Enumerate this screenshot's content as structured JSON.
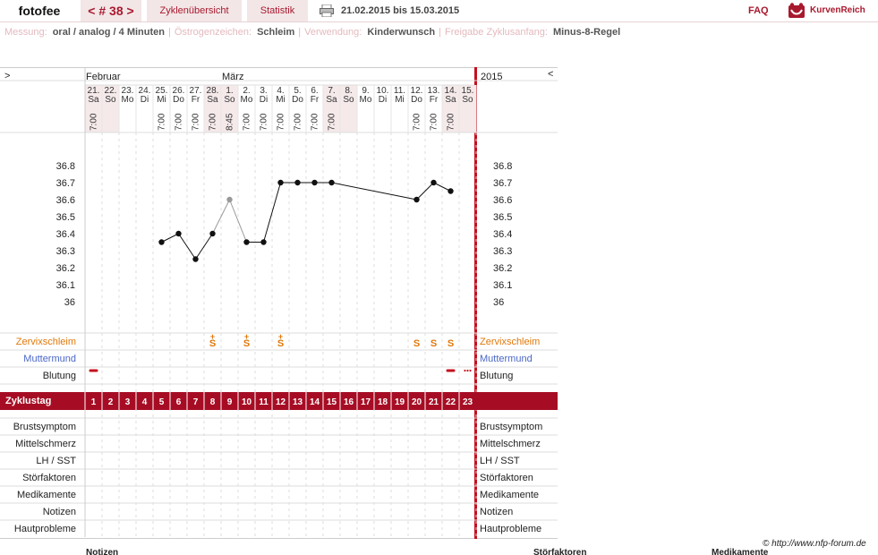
{
  "topbar": {
    "user": "fotofee",
    "cycle_label": "< # 38 >",
    "nav_overview": "Zyklenübersicht",
    "nav_stats": "Statistik",
    "date_range": "21.02.2015 bis 15.03.2015",
    "faq": "FAQ",
    "brand": "KurvenReich"
  },
  "meta": {
    "measure_key": "Messung:",
    "measure_val": "oral / analog / 4 Minuten",
    "oestro_key": "Östrogenzeichen:",
    "oestro_val": "Schleim",
    "use_key": "Verwendung:",
    "use_val": "Kinderwunsch",
    "free_key": "Freigabe Zyklusanfang:",
    "free_val": "Minus-8-Regel"
  },
  "header": {
    "left_arrow": ">",
    "right_arrow": "<",
    "month_feb": "Februar",
    "month_mar": "März",
    "year": "2015"
  },
  "chart_data": {
    "type": "line",
    "ylabel": "",
    "ylim": [
      35.9,
      36.95
    ],
    "ticks": [
      "36.8",
      "36.7",
      "36.6",
      "36.5",
      "36.4",
      "36.3",
      "36.2",
      "36.1",
      "36"
    ],
    "days": [
      {
        "date": "21.",
        "wd": "Sa",
        "time": "7:00",
        "weekend": true
      },
      {
        "date": "22.",
        "wd": "So",
        "time": "",
        "weekend": true
      },
      {
        "date": "23.",
        "wd": "Mo",
        "time": "",
        "weekend": false
      },
      {
        "date": "24.",
        "wd": "Di",
        "time": "",
        "weekend": false
      },
      {
        "date": "25.",
        "wd": "Mi",
        "time": "7:00",
        "weekend": false
      },
      {
        "date": "26.",
        "wd": "Do",
        "time": "7:00",
        "weekend": false
      },
      {
        "date": "27.",
        "wd": "Fr",
        "time": "7:00",
        "weekend": false
      },
      {
        "date": "28.",
        "wd": "Sa",
        "time": "7:00",
        "weekend": true
      },
      {
        "date": "1.",
        "wd": "So",
        "time": "8:45",
        "weekend": true
      },
      {
        "date": "2.",
        "wd": "Mo",
        "time": "7:00",
        "weekend": false
      },
      {
        "date": "3.",
        "wd": "Di",
        "time": "7:00",
        "weekend": false
      },
      {
        "date": "4.",
        "wd": "Mi",
        "time": "7:00",
        "weekend": false
      },
      {
        "date": "5.",
        "wd": "Do",
        "time": "7:00",
        "weekend": false
      },
      {
        "date": "6.",
        "wd": "Fr",
        "time": "7:00",
        "weekend": false
      },
      {
        "date": "7.",
        "wd": "Sa",
        "time": "7:00",
        "weekend": true
      },
      {
        "date": "8.",
        "wd": "So",
        "time": "",
        "weekend": true
      },
      {
        "date": "9.",
        "wd": "Mo",
        "time": "",
        "weekend": false
      },
      {
        "date": "10.",
        "wd": "Di",
        "time": "",
        "weekend": false
      },
      {
        "date": "11.",
        "wd": "Mi",
        "time": "",
        "weekend": false
      },
      {
        "date": "12.",
        "wd": "Do",
        "time": "7:00",
        "weekend": false
      },
      {
        "date": "13.",
        "wd": "Fr",
        "time": "7:00",
        "weekend": false
      },
      {
        "date": "14.",
        "wd": "Sa",
        "time": "7:00",
        "weekend": true
      },
      {
        "date": "15.",
        "wd": "So",
        "time": "",
        "weekend": true
      }
    ],
    "series": [
      {
        "values": [
          null,
          null,
          null,
          null,
          36.35,
          36.4,
          36.25,
          36.4,
          36.6,
          36.35,
          36.35,
          36.7,
          36.7,
          36.7,
          36.7,
          null,
          null,
          null,
          null,
          36.6,
          36.7,
          36.65,
          null
        ],
        "excluded_day": 9
      }
    ],
    "cycle_days": [
      "1",
      "2",
      "3",
      "4",
      "5",
      "6",
      "7",
      "8",
      "9",
      "10",
      "11",
      "12",
      "13",
      "14",
      "15",
      "16",
      "17",
      "18",
      "19",
      "20",
      "21",
      "22",
      "23"
    ]
  },
  "rows": {
    "zervix": "Zervixschleim",
    "muttermund": "Muttermund",
    "blutung": "Blutung",
    "zyklustag": "Zyklustag",
    "brust": "Brustsymptom",
    "mittel": "Mittelschmerz",
    "lh": "LH / SST",
    "stoer": "Störfaktoren",
    "medi": "Medikamente",
    "notizen": "Notizen",
    "haut": "Hautprobleme"
  },
  "symptoms": {
    "mucus_days": [
      8,
      10,
      12,
      20,
      21,
      22
    ],
    "mucus_plus_days": [
      8,
      10,
      12
    ],
    "mucus_glyph": "S",
    "mucus_plus": "+",
    "bleeding_days": [
      1,
      22
    ],
    "spotting_day": 23,
    "bleeding_glyph": "▬",
    "spotting_glyph": "•••"
  },
  "colors": {
    "accent": "#a8192e",
    "band": "#a60d24",
    "mucus": "#e0780a",
    "muttermund": "#4a67c8",
    "bleeding": "#c4101e"
  },
  "footer": {
    "copyright": "© http://www.nfp-forum.de",
    "col1": "Notizen",
    "col2": "Störfaktoren",
    "col3": "Medikamente"
  }
}
